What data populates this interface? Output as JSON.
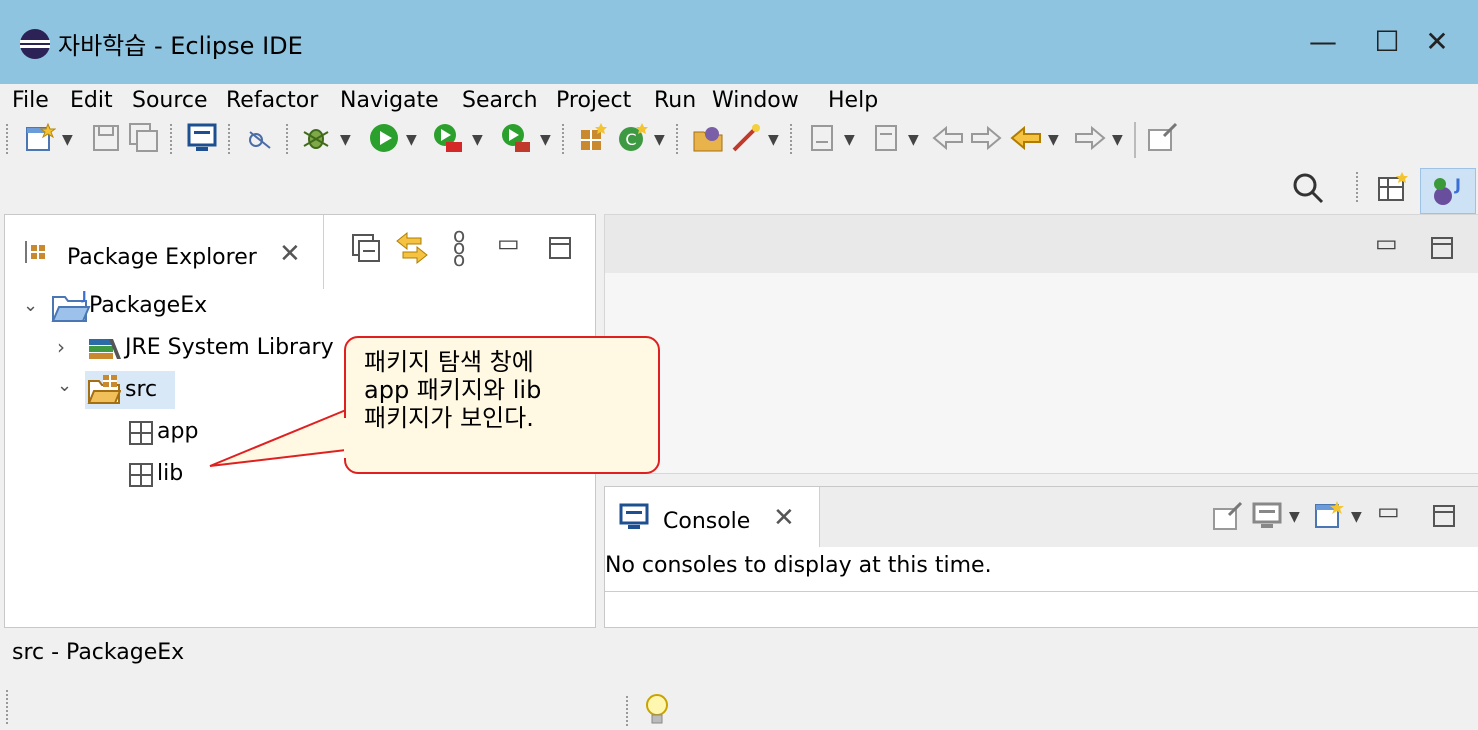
{
  "window": {
    "title": "자바학습 - Eclipse IDE",
    "controls": {
      "minimize": "—",
      "maximize": "☐",
      "close": "✕"
    }
  },
  "menu": [
    "File",
    "Edit",
    "Source",
    "Refactor",
    "Navigate",
    "Search",
    "Project",
    "Run",
    "Window",
    "Help"
  ],
  "package_explorer": {
    "tab_label": "Package Explorer",
    "tree": {
      "project": "PackageEx",
      "library": "JRE System Library",
      "src": "src",
      "packages": [
        "app",
        "lib"
      ]
    }
  },
  "callout": {
    "lines": [
      "패키지 탐색 창에",
      "app 패키지와 lib",
      "패키지가 보인다."
    ]
  },
  "console": {
    "tab_label": "Console",
    "message": "No consoles to display at this time."
  },
  "status": {
    "text": "src - PackageEx"
  },
  "colors": {
    "titlebar": "#8ec4e0",
    "callout_border": "#e02020",
    "callout_fill": "#fff9e3",
    "selection": "#d9e8f7"
  }
}
